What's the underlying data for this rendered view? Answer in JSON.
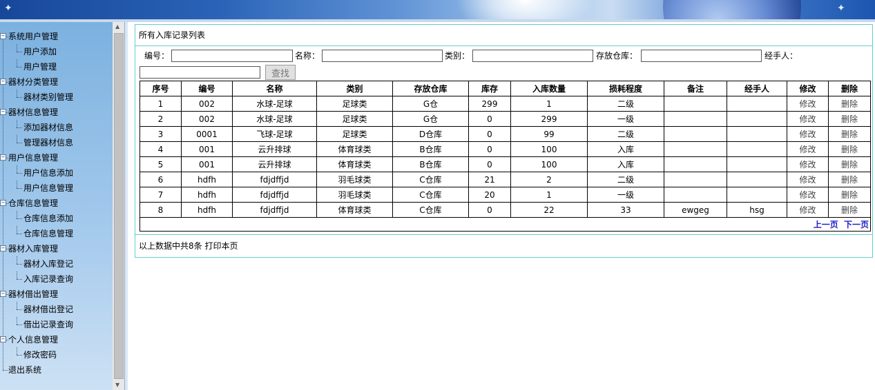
{
  "sidebar": {
    "groups": [
      {
        "label": "系统用户管理",
        "items": [
          "用户添加",
          "用户管理"
        ]
      },
      {
        "label": "器材分类管理",
        "items": [
          "器材类别管理"
        ]
      },
      {
        "label": "器材信息管理",
        "items": [
          "添加器材信息",
          "管理器材信息"
        ]
      },
      {
        "label": "用户信息管理",
        "items": [
          "用户信息添加",
          "用户信息管理"
        ]
      },
      {
        "label": "仓库信息管理",
        "items": [
          "仓库信息添加",
          "仓库信息管理"
        ]
      },
      {
        "label": "器材入库管理",
        "items": [
          "器材入库登记",
          "入库记录查询"
        ]
      },
      {
        "label": "器材借出管理",
        "items": [
          "器材借出登记",
          "借出记录查询"
        ]
      },
      {
        "label": "个人信息管理",
        "items": [
          "修改密码"
        ]
      }
    ],
    "logout": "退出系统"
  },
  "panel": {
    "title": "所有入库记录列表",
    "footer": "以上数据中共8条 打印本页"
  },
  "search": {
    "labels": [
      "编号：",
      "名称：",
      "类别：",
      "存放仓库：",
      "经手人："
    ],
    "values": [
      "",
      "",
      "",
      "",
      ""
    ],
    "button": "查找"
  },
  "table": {
    "headers": [
      "序号",
      "编号",
      "名称",
      "类别",
      "存放仓库",
      "库存",
      "入库数量",
      "损耗程度",
      "备注",
      "经手人",
      "修改",
      "删除"
    ],
    "rows": [
      [
        "1",
        "002",
        "水球-足球",
        "足球类",
        "G仓",
        "299",
        "1",
        "二级",
        "",
        "",
        "修改",
        "删除"
      ],
      [
        "2",
        "002",
        "水球-足球",
        "足球类",
        "G仓",
        "0",
        "299",
        "一级",
        "",
        "",
        "修改",
        "删除"
      ],
      [
        "3",
        "0001",
        "飞球-足球",
        "足球类",
        "D仓库",
        "0",
        "99",
        "二级",
        "",
        "",
        "修改",
        "删除"
      ],
      [
        "4",
        "001",
        "云升排球",
        "体育球类",
        "B仓库",
        "0",
        "100",
        "入库",
        "",
        "",
        "修改",
        "删除"
      ],
      [
        "5",
        "001",
        "云升排球",
        "体育球类",
        "B仓库",
        "0",
        "100",
        "入库",
        "",
        "",
        "修改",
        "删除"
      ],
      [
        "6",
        "hdfh",
        "fdjdffjd",
        "羽毛球类",
        "C仓库",
        "21",
        "2",
        "二级",
        "",
        "",
        "修改",
        "删除"
      ],
      [
        "7",
        "hdfh",
        "fdjdffjd",
        "羽毛球类",
        "C仓库",
        "20",
        "1",
        "一级",
        "",
        "",
        "修改",
        "删除"
      ],
      [
        "8",
        "hdfh",
        "fdjdffjd",
        "体育球类",
        "C仓库",
        "0",
        "22",
        "33",
        "ewgeg",
        "hsg",
        "修改",
        "删除"
      ]
    ],
    "pager": {
      "prev": "上一页",
      "next": "下一页"
    }
  },
  "colors": {
    "panel_border": "#66cccc",
    "pager_link": "#1d1dcc",
    "sidebar_top": "#7cb1df"
  }
}
